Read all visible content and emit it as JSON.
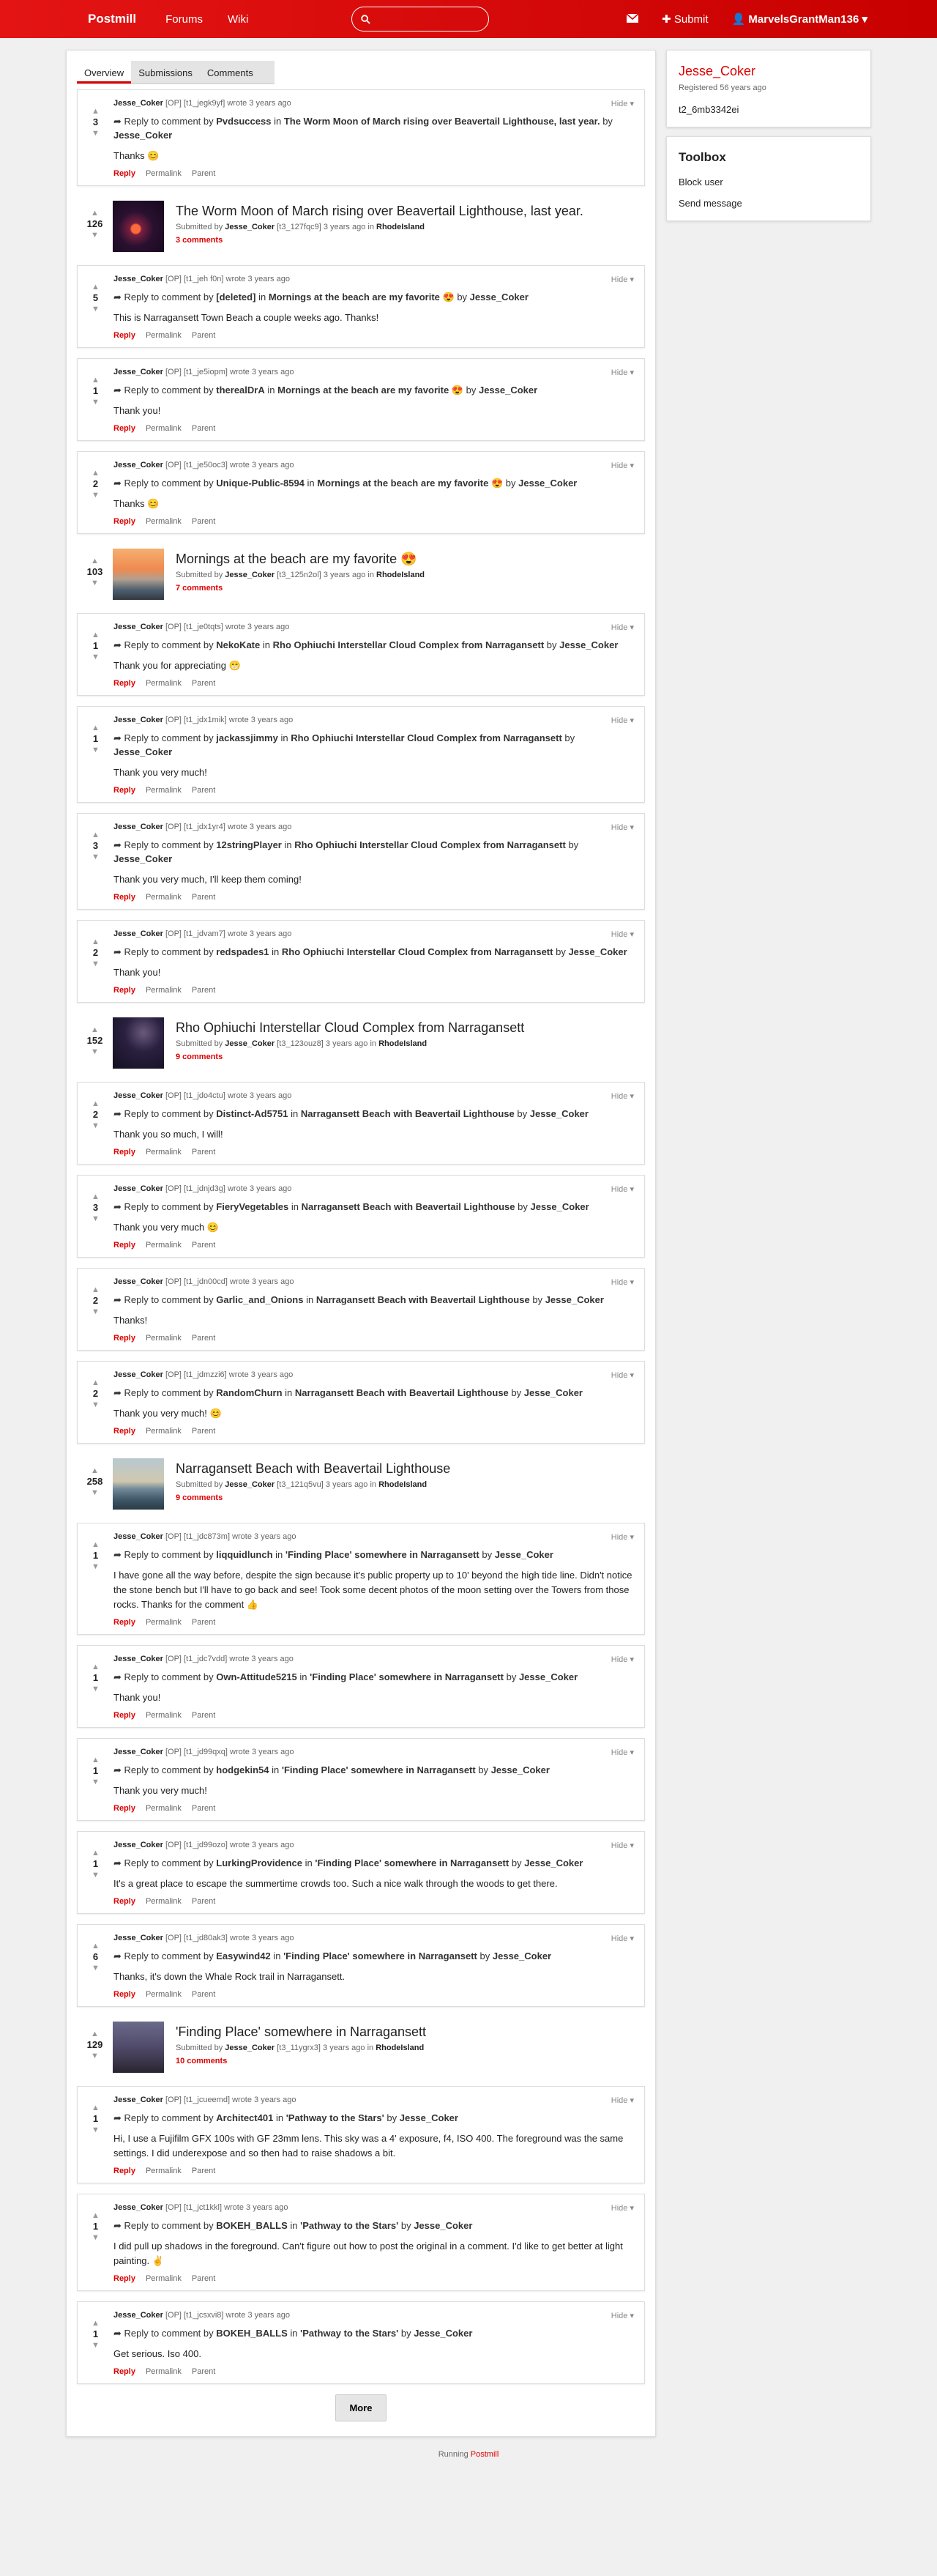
{
  "navbar": {
    "brand": "Postmill",
    "links": [
      "Forums",
      "Wiki"
    ],
    "search_placeholder": "",
    "submit_label": "Submit",
    "user_label": "MarvelsGrantMan136"
  },
  "tabs": [
    {
      "label": "Overview",
      "active": true
    },
    {
      "label": "Submissions",
      "active": false
    },
    {
      "label": "Comments",
      "active": false
    }
  ],
  "feed": [
    {
      "kind": "comment",
      "score": "3",
      "author": "Jesse_Coker",
      "op": "[OP]",
      "cid": "[t1_jegk9yf]",
      "when": "wrote 3 years ago",
      "to_user": "Pvdsuccess",
      "to_post": "The Worm Moon of March rising over Beavertail Lighthouse, last year.",
      "by": "Jesse_Coker",
      "text": "Thanks 😊"
    },
    {
      "kind": "submission",
      "score": "126",
      "title": "The Worm Moon of March rising over Beavertail Lighthouse, last year.",
      "author": "Jesse_Coker",
      "sid": "[t3_127fqc9]",
      "when": "3 years ago",
      "forum": "RhodeIsland",
      "comments": "3 comments",
      "thumb": "moon"
    },
    {
      "kind": "comment",
      "score": "5",
      "author": "Jesse_Coker",
      "op": "[OP]",
      "cid": "[t1_jeh f0n]",
      "when": "wrote 3 years ago",
      "to_user": "[deleted]",
      "to_post": "Mornings at the beach are my favorite 😍",
      "by": "Jesse_Coker",
      "text": "This is Narragansett Town Beach a couple weeks ago. Thanks!"
    },
    {
      "kind": "comment",
      "score": "1",
      "author": "Jesse_Coker",
      "op": "[OP]",
      "cid": "[t1_je5iopm]",
      "when": "wrote 3 years ago",
      "to_user": "therealDrA",
      "to_post": "Mornings at the beach are my favorite 😍",
      "by": "Jesse_Coker",
      "text": "Thank you!"
    },
    {
      "kind": "comment",
      "score": "2",
      "author": "Jesse_Coker",
      "op": "[OP]",
      "cid": "[t1_je50oc3]",
      "when": "wrote 3 years ago",
      "to_user": "Unique-Public-8594",
      "to_post": "Mornings at the beach are my favorite 😍",
      "by": "Jesse_Coker",
      "text": "Thanks 😊"
    },
    {
      "kind": "submission",
      "score": "103",
      "title": "Mornings at the beach are my favorite 😍",
      "author": "Jesse_Coker",
      "sid": "[t3_125n2ol]",
      "when": "3 years ago",
      "forum": "RhodeIsland",
      "comments": "7 comments",
      "thumb": "beach"
    },
    {
      "kind": "comment",
      "score": "1",
      "author": "Jesse_Coker",
      "op": "[OP]",
      "cid": "[t1_je0tqts]",
      "when": "wrote 3 years ago",
      "to_user": "NekoKate",
      "to_post": "Rho Ophiuchi Interstellar Cloud Complex from Narragansett",
      "by": "Jesse_Coker",
      "text": "Thank you for appreciating 😁"
    },
    {
      "kind": "comment",
      "score": "1",
      "author": "Jesse_Coker",
      "op": "[OP]",
      "cid": "[t1_jdx1mik]",
      "when": "wrote 3 years ago",
      "to_user": "jackassjimmy",
      "to_post": "Rho Ophiuchi Interstellar Cloud Complex from Narragansett",
      "by": "Jesse_Coker",
      "text": "Thank you very much!"
    },
    {
      "kind": "comment",
      "score": "3",
      "author": "Jesse_Coker",
      "op": "[OP]",
      "cid": "[t1_jdx1yr4]",
      "when": "wrote 3 years ago",
      "to_user": "12stringPlayer",
      "to_post": "Rho Ophiuchi Interstellar Cloud Complex from Narragansett",
      "by": "Jesse_Coker",
      "text": "Thank you very much, I'll keep them coming!"
    },
    {
      "kind": "comment",
      "score": "2",
      "author": "Jesse_Coker",
      "op": "[OP]",
      "cid": "[t1_jdvam7]",
      "when": "wrote 3 years ago",
      "to_user": "redspades1",
      "to_post": "Rho Ophiuchi Interstellar Cloud Complex from Narragansett",
      "by": "Jesse_Coker",
      "text": "Thank you!"
    },
    {
      "kind": "submission",
      "score": "152",
      "title": "Rho Ophiuchi Interstellar Cloud Complex from Narragansett",
      "author": "Jesse_Coker",
      "sid": "[t3_123ouz8]",
      "when": "3 years ago",
      "forum": "RhodeIsland",
      "comments": "9 comments",
      "thumb": "stars"
    },
    {
      "kind": "comment",
      "score": "2",
      "author": "Jesse_Coker",
      "op": "[OP]",
      "cid": "[t1_jdo4ctu]",
      "when": "wrote 3 years ago",
      "to_user": "Distinct-Ad5751",
      "to_post": "Narragansett Beach with Beavertail Lighthouse",
      "by": "Jesse_Coker",
      "text": "Thank you so much, I will!"
    },
    {
      "kind": "comment",
      "score": "3",
      "author": "Jesse_Coker",
      "op": "[OP]",
      "cid": "[t1_jdnjd3g]",
      "when": "wrote 3 years ago",
      "to_user": "FieryVegetables",
      "to_post": "Narragansett Beach with Beavertail Lighthouse",
      "by": "Jesse_Coker",
      "text": "Thank you very much 😊"
    },
    {
      "kind": "comment",
      "score": "2",
      "author": "Jesse_Coker",
      "op": "[OP]",
      "cid": "[t1_jdn00cd]",
      "when": "wrote 3 years ago",
      "to_user": "Garlic_and_Onions",
      "to_post": "Narragansett Beach with Beavertail Lighthouse",
      "by": "Jesse_Coker",
      "text": "Thanks!"
    },
    {
      "kind": "comment",
      "score": "2",
      "author": "Jesse_Coker",
      "op": "[OP]",
      "cid": "[t1_jdmzzi6]",
      "when": "wrote 3 years ago",
      "to_user": "RandomChurn",
      "to_post": "Narragansett Beach with Beavertail Lighthouse",
      "by": "Jesse_Coker",
      "text": "Thank you very much! 😊"
    },
    {
      "kind": "submission",
      "score": "258",
      "title": "Narragansett Beach with Beavertail Lighthouse",
      "author": "Jesse_Coker",
      "sid": "[t3_121q5vu]",
      "when": "3 years ago",
      "forum": "RhodeIsland",
      "comments": "9 comments",
      "thumb": "lighthouse"
    },
    {
      "kind": "comment",
      "score": "1",
      "author": "Jesse_Coker",
      "op": "[OP]",
      "cid": "[t1_jdc873m]",
      "when": "wrote 3 years ago",
      "to_user": "liqquidlunch",
      "to_post": "'Finding Place' somewhere in Narragansett",
      "by": "Jesse_Coker",
      "text": "I have gone all the way before, despite the sign because it's public property up to 10' beyond the high tide line. Didn't notice the stone bench but I'll have to go back and see! Took some decent photos of the moon setting over the Towers from those rocks. Thanks for the comment 👍"
    },
    {
      "kind": "comment",
      "score": "1",
      "author": "Jesse_Coker",
      "op": "[OP]",
      "cid": "[t1_jdc7vdd]",
      "when": "wrote 3 years ago",
      "to_user": "Own-Attitude5215",
      "to_post": "'Finding Place' somewhere in Narragansett",
      "by": "Jesse_Coker",
      "text": "Thank you!"
    },
    {
      "kind": "comment",
      "score": "1",
      "author": "Jesse_Coker",
      "op": "[OP]",
      "cid": "[t1_jd99qxq]",
      "when": "wrote 3 years ago",
      "to_user": "hodgekin54",
      "to_post": "'Finding Place' somewhere in Narragansett",
      "by": "Jesse_Coker",
      "text": "Thank you very much!"
    },
    {
      "kind": "comment",
      "score": "1",
      "author": "Jesse_Coker",
      "op": "[OP]",
      "cid": "[t1_jd99ozo]",
      "when": "wrote 3 years ago",
      "to_user": "LurkingProvidence",
      "to_post": "'Finding Place' somewhere in Narragansett",
      "by": "Jesse_Coker",
      "text": "It's a great place to escape the summertime crowds too. Such a nice walk through the woods to get there."
    },
    {
      "kind": "comment",
      "score": "6",
      "author": "Jesse_Coker",
      "op": "[OP]",
      "cid": "[t1_jd80ak3]",
      "when": "wrote 3 years ago",
      "to_user": "Easywind42",
      "to_post": "'Finding Place' somewhere in Narragansett",
      "by": "Jesse_Coker",
      "text": "Thanks, it's down the Whale Rock trail in Narragansett."
    },
    {
      "kind": "submission",
      "score": "129",
      "title": "'Finding Place' somewhere in Narragansett",
      "author": "Jesse_Coker",
      "sid": "[t3_11ygrx3]",
      "when": "3 years ago",
      "forum": "RhodeIsland",
      "comments": "10 comments",
      "thumb": "shore"
    },
    {
      "kind": "comment",
      "score": "1",
      "author": "Jesse_Coker",
      "op": "[OP]",
      "cid": "[t1_jcueemd]",
      "when": "wrote 3 years ago",
      "to_user": "Architect401",
      "to_post": "'Pathway to the Stars'",
      "by": "Jesse_Coker",
      "text": "Hi, I use a Fujifilm GFX 100s with GF 23mm lens. This sky was a 4' exposure, f4, ISO 400. The foreground was the same settings. I did underexpose and so then had to raise shadows a bit."
    },
    {
      "kind": "comment",
      "score": "1",
      "author": "Jesse_Coker",
      "op": "[OP]",
      "cid": "[t1_jct1kkl]",
      "when": "wrote 3 years ago",
      "to_user": "BOKEH_BALLS",
      "to_post": "'Pathway to the Stars'",
      "by": "Jesse_Coker",
      "text": "I did pull up shadows in the foreground. Can't figure out how to post the original in a comment. I'd like to get better at light painting. ✌️"
    },
    {
      "kind": "comment",
      "score": "1",
      "author": "Jesse_Coker",
      "op": "[OP]",
      "cid": "[t1_jcsxvi8]",
      "when": "wrote 3 years ago",
      "to_user": "BOKEH_BALLS",
      "to_post": "'Pathway to the Stars'",
      "by": "Jesse_Coker",
      "text": "Get serious. Iso 400."
    }
  ],
  "labels": {
    "reply_to": "Reply to comment by",
    "in": "in",
    "by": "by",
    "hide": "Hide",
    "reply": "Reply",
    "permalink": "Permalink",
    "parent": "Parent",
    "submitted_by": "Submitted by",
    "in_forum": "in"
  },
  "more_label": "More",
  "sidebar": {
    "username": "Jesse_Coker",
    "registered": "Registered 56 years ago",
    "user_id": "t2_6mb3342ei",
    "toolbox_title": "Toolbox",
    "tools": [
      "Block user",
      "Send message"
    ]
  },
  "footer": {
    "prefix": "Running",
    "app": "Postmill"
  },
  "colors": {
    "accent": "#d00000",
    "navbar": "#e41414"
  }
}
